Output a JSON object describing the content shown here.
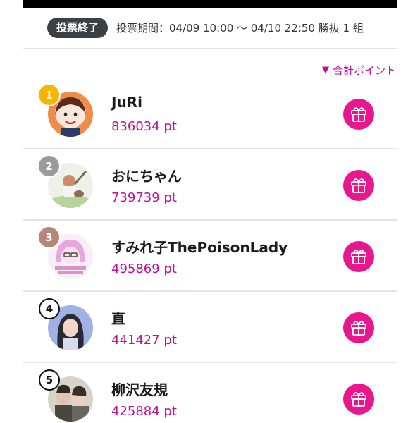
{
  "header": {
    "status_badge": "投票終了",
    "period_text": "投票期間：04/09 10:00 〜 04/10 22:50  勝抜 1 組"
  },
  "sort": {
    "label": "合計ポイント",
    "icon": "triangle-down-icon"
  },
  "colors": {
    "accent": "#c20d95",
    "gift": "#e8178e",
    "badge": "#3b4045"
  },
  "ranking": [
    {
      "rank": "1",
      "name": "JuRi",
      "points": "836034 pt"
    },
    {
      "rank": "2",
      "name": "おにちゃん",
      "points": "739739 pt"
    },
    {
      "rank": "3",
      "name": "すみれ子ThePoisonLady",
      "points": "495869 pt"
    },
    {
      "rank": "4",
      "name": "直",
      "points": "441427 pt"
    },
    {
      "rank": "5",
      "name": "柳沢友規",
      "points": "425884 pt"
    }
  ]
}
